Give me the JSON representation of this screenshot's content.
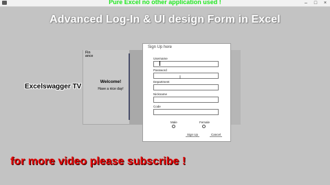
{
  "window": {
    "icon": "excel-app-icon",
    "controls": [
      "minimize-icon",
      "maximize-icon",
      "close-icon"
    ],
    "minimize_glyph": "–",
    "maximize_glyph": "□",
    "close_glyph": "×"
  },
  "banner": {
    "text": "Pure Excel no other application used !"
  },
  "headline": "Advanced Log-In & UI design Form in Excel",
  "channel": "Excelswagger TV",
  "subscribe": "for more video please subscribe !",
  "left_panel": {
    "logo_line1": "Fin",
    "logo_line2": "ance",
    "welcome_title": "Welcome!",
    "welcome_sub": "Have a nice day!"
  },
  "form": {
    "title": "Sign Up here",
    "fields": [
      {
        "label": "Username",
        "value": ""
      },
      {
        "label": "Password",
        "value": ""
      },
      {
        "label": "Department",
        "value": ""
      },
      {
        "label": "Nickname",
        "value": ""
      },
      {
        "label": "Code",
        "value": ""
      }
    ],
    "gender_options": [
      "Male",
      "Female"
    ],
    "signup_label": "Sign Up",
    "cancel_label": "Cancel"
  },
  "colors": {
    "banner": "#1ee61e",
    "subscribe": "#e60000",
    "divider": "#4a4f6a",
    "background": "#c3c3c3"
  }
}
